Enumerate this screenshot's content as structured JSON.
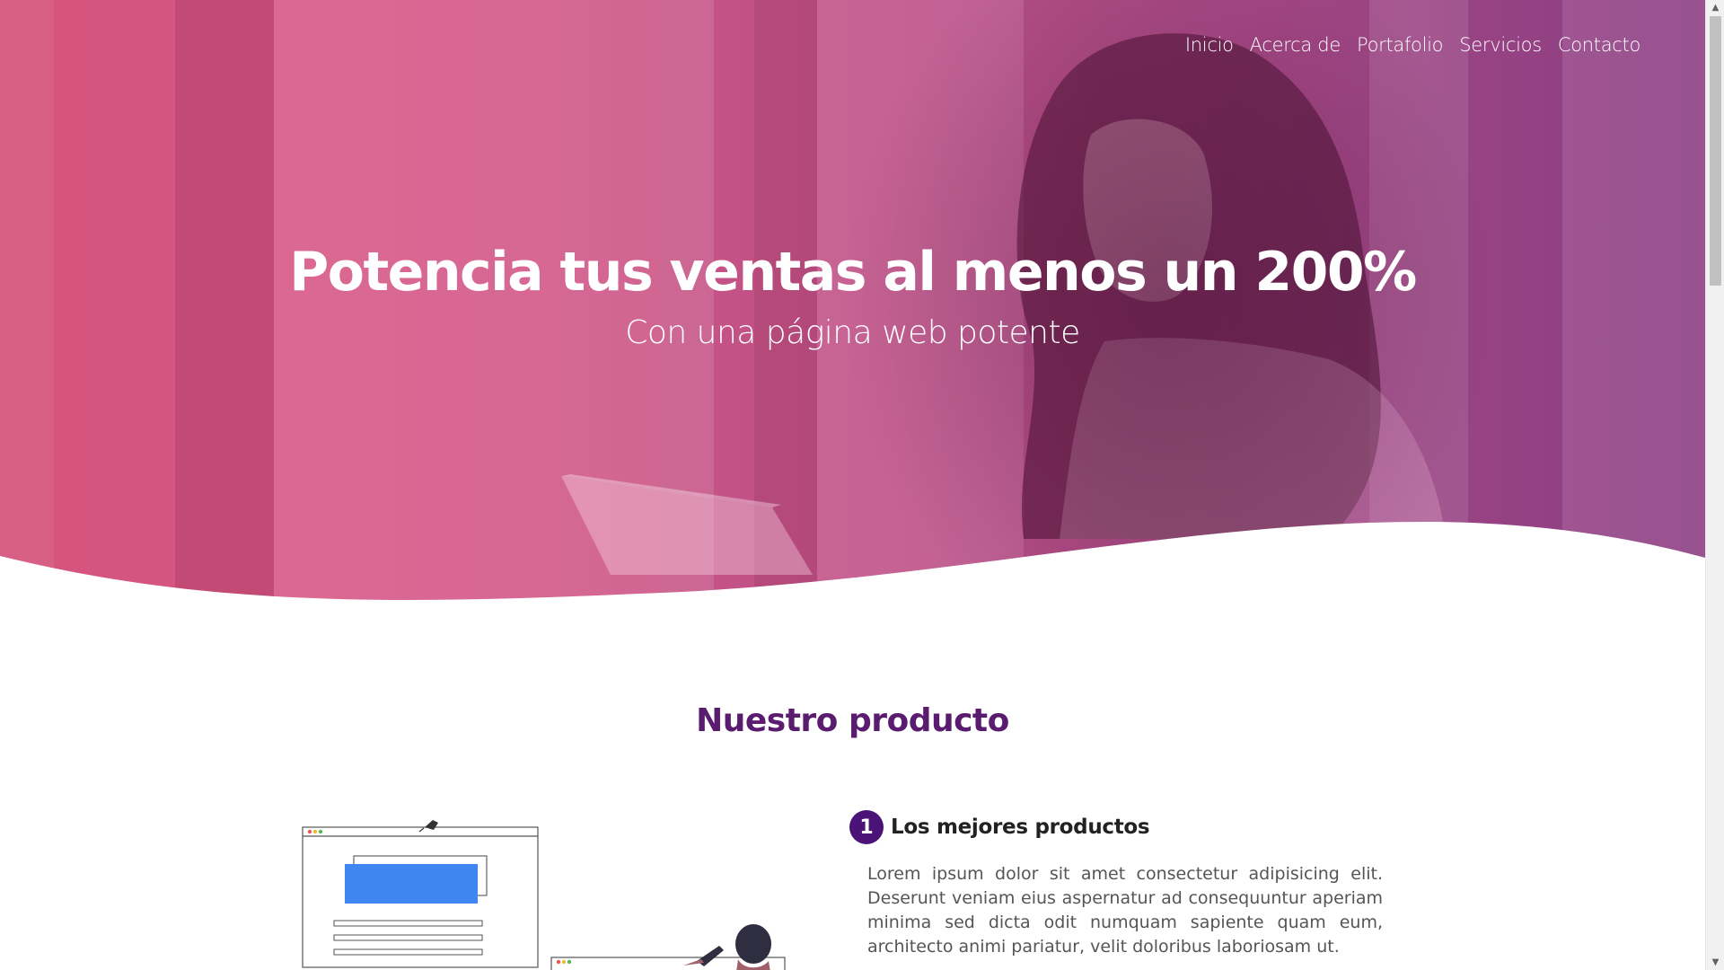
{
  "nav": {
    "items": [
      "Inicio",
      "Acerca de",
      "Portafolio",
      "Servicios",
      "Contacto"
    ]
  },
  "hero": {
    "title": "Potencia tus ventas al menos un 200%",
    "subtitle": "Con una página web potente",
    "overlay_colors": [
      "#d6557e",
      "#8a3e82"
    ]
  },
  "product": {
    "section_title": "Nuestro producto",
    "features": [
      {
        "number": "1",
        "title": "Los mejores productos",
        "text": "Lorem ipsum dolor sit amet consectetur adipisicing elit. Deserunt veniam eius aspernatur ad consequuntur aperiam minima sed dicta odit numquam sapiente quam eum, architecto animi pariatur, velit doloribus laboriosam ut."
      }
    ]
  },
  "colors": {
    "title_purple": "#5a1c6e",
    "badge_purple": "#4b1278",
    "illustration_blue": "#3f86f0"
  }
}
